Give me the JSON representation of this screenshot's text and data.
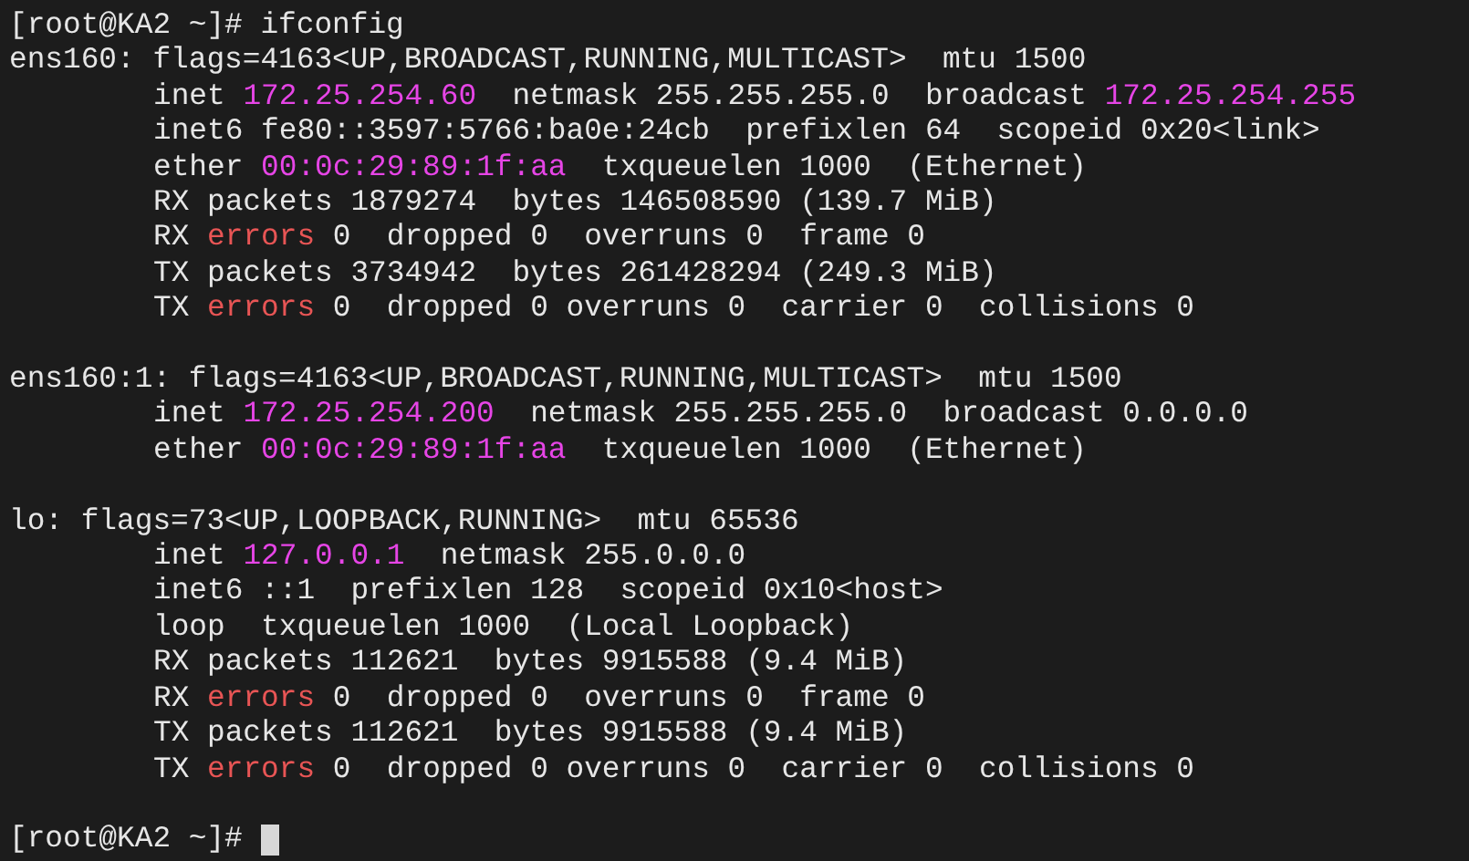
{
  "command_line": {
    "prompt": "[root@KA2 ~]#",
    "command": "ifconfig"
  },
  "interfaces": [
    {
      "header": [
        {
          "kind": "plain",
          "text": "ens160: flags=4163<UP,BROADCAST,RUNNING,MULTICAST>  mtu 1500"
        }
      ],
      "details": [
        [
          {
            "kind": "plain",
            "text": "inet "
          },
          {
            "kind": "address",
            "text": "172.25.254.60"
          },
          {
            "kind": "plain",
            "text": "  netmask 255.255.255.0  broadcast "
          },
          {
            "kind": "address",
            "text": "172.25.254.255"
          }
        ],
        [
          {
            "kind": "plain",
            "text": "inet6 fe80::3597:5766:ba0e:24cb  prefixlen 64  scopeid 0x20<link>"
          }
        ],
        [
          {
            "kind": "plain",
            "text": "ether "
          },
          {
            "kind": "address",
            "text": "00:0c:29:89:1f:aa"
          },
          {
            "kind": "plain",
            "text": "  txqueuelen 1000  (Ethernet)"
          }
        ],
        [
          {
            "kind": "plain",
            "text": "RX packets 1879274  bytes 146508590 (139.7 MiB)"
          }
        ],
        [
          {
            "kind": "plain",
            "text": "RX "
          },
          {
            "kind": "error",
            "text": "errors"
          },
          {
            "kind": "plain",
            "text": " 0  dropped 0  overruns 0  frame 0"
          }
        ],
        [
          {
            "kind": "plain",
            "text": "TX packets 3734942  bytes 261428294 (249.3 MiB)"
          }
        ],
        [
          {
            "kind": "plain",
            "text": "TX "
          },
          {
            "kind": "error",
            "text": "errors"
          },
          {
            "kind": "plain",
            "text": " 0  dropped 0 overruns 0  carrier 0  collisions 0"
          }
        ]
      ]
    },
    {
      "header": [
        {
          "kind": "plain",
          "text": "ens160:1: flags=4163<UP,BROADCAST,RUNNING,MULTICAST>  mtu 1500"
        }
      ],
      "details": [
        [
          {
            "kind": "plain",
            "text": "inet "
          },
          {
            "kind": "address",
            "text": "172.25.254.200"
          },
          {
            "kind": "plain",
            "text": "  netmask 255.255.255.0  broadcast 0.0.0.0"
          }
        ],
        [
          {
            "kind": "plain",
            "text": "ether "
          },
          {
            "kind": "address",
            "text": "00:0c:29:89:1f:aa"
          },
          {
            "kind": "plain",
            "text": "  txqueuelen 1000  (Ethernet)"
          }
        ]
      ]
    },
    {
      "header": [
        {
          "kind": "plain",
          "text": "lo: flags=73<UP,LOOPBACK,RUNNING>  mtu 65536"
        }
      ],
      "details": [
        [
          {
            "kind": "plain",
            "text": "inet "
          },
          {
            "kind": "address",
            "text": "127.0.0.1"
          },
          {
            "kind": "plain",
            "text": "  netmask 255.0.0.0"
          }
        ],
        [
          {
            "kind": "plain",
            "text": "inet6 ::1  prefixlen 128  scopeid 0x10<host>"
          }
        ],
        [
          {
            "kind": "plain",
            "text": "loop  txqueuelen 1000  (Local Loopback)"
          }
        ],
        [
          {
            "kind": "plain",
            "text": "RX packets 112621  bytes 9915588 (9.4 MiB)"
          }
        ],
        [
          {
            "kind": "plain",
            "text": "RX "
          },
          {
            "kind": "error",
            "text": "errors"
          },
          {
            "kind": "plain",
            "text": " 0  dropped 0  overruns 0  frame 0"
          }
        ],
        [
          {
            "kind": "plain",
            "text": "TX packets 112621  bytes 9915588 (9.4 MiB)"
          }
        ],
        [
          {
            "kind": "plain",
            "text": "TX "
          },
          {
            "kind": "error",
            "text": "errors"
          },
          {
            "kind": "plain",
            "text": " 0  dropped 0 overruns 0  carrier 0  collisions 0"
          }
        ]
      ]
    }
  ],
  "final_prompt": {
    "prompt": "[root@KA2 ~]#"
  }
}
